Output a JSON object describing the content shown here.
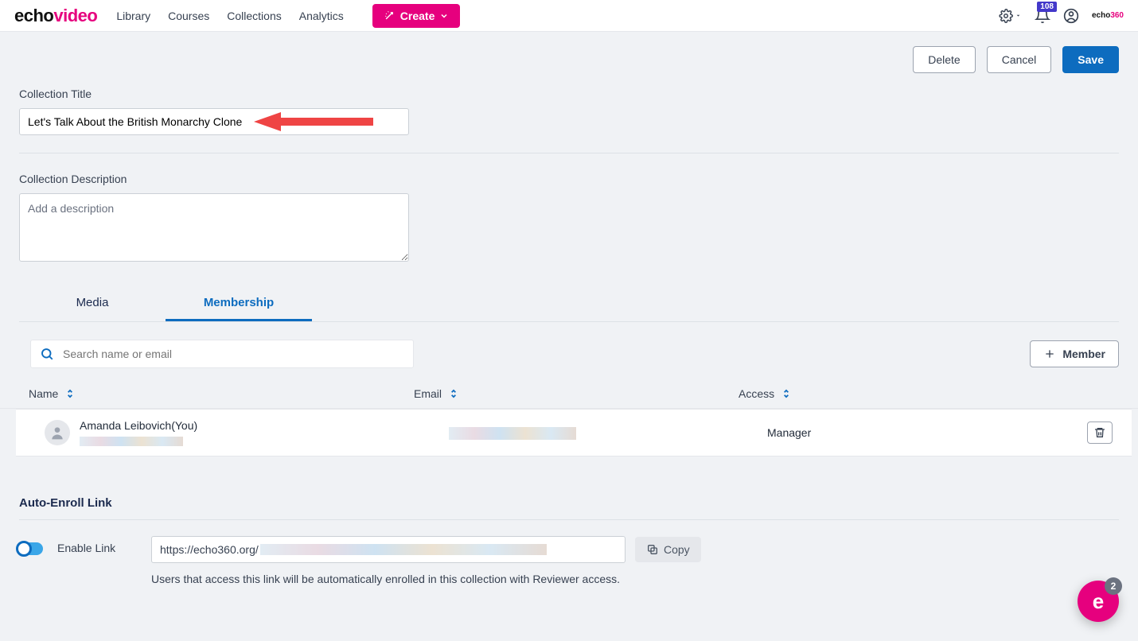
{
  "brand": {
    "part1": "echo",
    "part2": "video"
  },
  "nav": {
    "library": "Library",
    "courses": "Courses",
    "collections": "Collections",
    "analytics": "Analytics",
    "create": "Create",
    "notif_count": "108"
  },
  "actions": {
    "delete": "Delete",
    "cancel": "Cancel",
    "save": "Save"
  },
  "title": {
    "label": "Collection Title",
    "value": "Let's Talk About the British Monarchy Clone"
  },
  "description": {
    "label": "Collection Description",
    "placeholder": "Add a description",
    "value": ""
  },
  "tabs": {
    "media": "Media",
    "membership": "Membership"
  },
  "membership": {
    "search_placeholder": "Search name or email",
    "add_member": "Member",
    "cols": {
      "name": "Name",
      "email": "Email",
      "access": "Access"
    },
    "rows": [
      {
        "name": "Amanda Leibovich",
        "you_suffix": "(You)",
        "access": "Manager"
      }
    ]
  },
  "auto_enroll": {
    "section": "Auto-Enroll Link",
    "enable_label": "Enable Link",
    "link_prefix": "https://echo360.org",
    "copy": "Copy",
    "help": "Users that access this link will be automatically enrolled in this collection with Reviewer access."
  },
  "chat": {
    "badge": "2"
  }
}
